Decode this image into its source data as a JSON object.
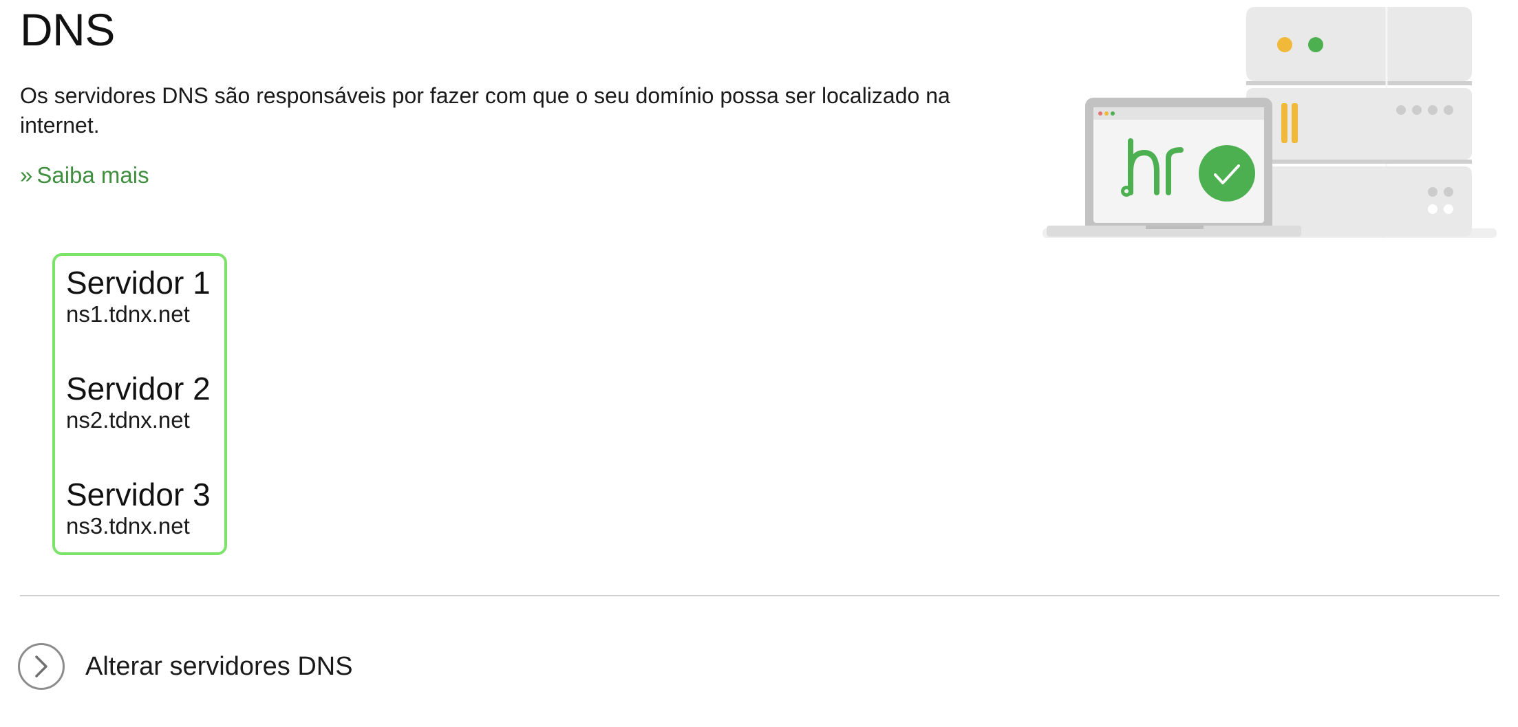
{
  "header": {
    "title": "DNS",
    "description": "Os servidores DNS são responsáveis por fazer com que o seu domínio possa ser localizado na internet.",
    "learn_more_prefix": "»",
    "learn_more_label": "Saiba mais"
  },
  "illustration": {
    "logo_text": "br",
    "icons": [
      "server-rack-icon",
      "laptop-icon",
      "checkmark-icon"
    ],
    "colors": {
      "green": "#4caf50",
      "yellow": "#f1b93a",
      "gray": "#e6e6e6"
    }
  },
  "servers": [
    {
      "name": "Servidor 1",
      "value": "ns1.tdnx.net"
    },
    {
      "name": "Servidor 2",
      "value": "ns2.tdnx.net"
    },
    {
      "name": "Servidor 3",
      "value": "ns3.tdnx.net"
    }
  ],
  "actions": {
    "change_dns_label": "Alterar servidores DNS",
    "change_dns_icon": "chevron-right-icon"
  },
  "colors": {
    "accent": "#3f8f3f",
    "highlight_border": "#7be36a",
    "divider": "#cfcfcf"
  }
}
